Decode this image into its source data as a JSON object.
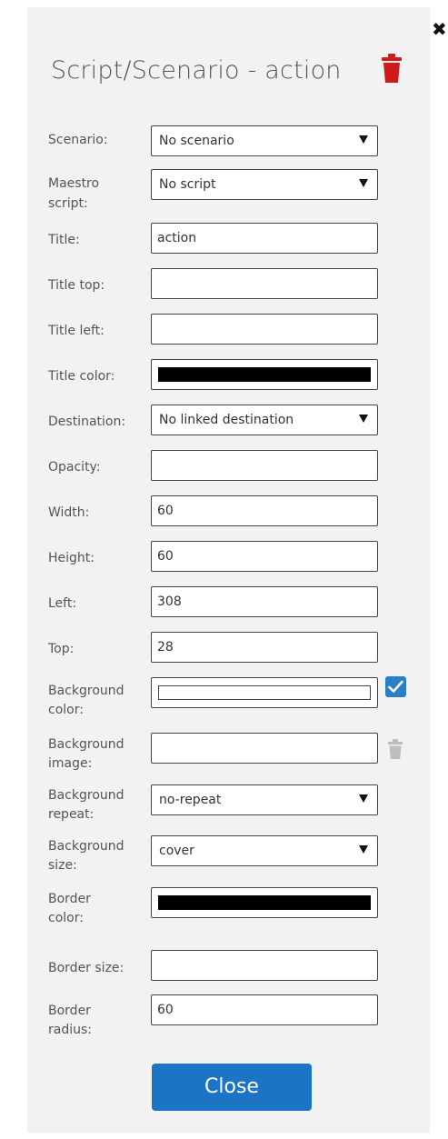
{
  "dialog": {
    "title": "Script/Scenario - action",
    "close_label": "Close"
  },
  "fields": {
    "scenario": {
      "label": "Scenario:",
      "value": "No scenario"
    },
    "maestro": {
      "label1": "Maestro",
      "label2": "script:",
      "value": "No script"
    },
    "title": {
      "label": "Title:",
      "value": "action"
    },
    "title_top": {
      "label": "Title top:",
      "value": ""
    },
    "title_left": {
      "label": "Title left:",
      "value": ""
    },
    "title_color": {
      "label": "Title color:",
      "color": "#000000"
    },
    "destination": {
      "label": "Destination:",
      "value": "No linked destination"
    },
    "opacity": {
      "label": "Opacity:",
      "value": ""
    },
    "width": {
      "label": "Width:",
      "value": "60"
    },
    "height": {
      "label": "Height:",
      "value": "60"
    },
    "left": {
      "label": "Left:",
      "value": "308"
    },
    "top": {
      "label": "Top:",
      "value": "28"
    },
    "bg_color": {
      "label1": "Background",
      "label2": "color:",
      "color": "#ffffff"
    },
    "bg_image": {
      "label1": "Background",
      "label2": "image:",
      "value": ""
    },
    "bg_repeat": {
      "label1": "Background",
      "label2": "repeat:",
      "value": "no-repeat"
    },
    "bg_size": {
      "label1": "Background",
      "label2": "size:",
      "value": "cover"
    },
    "border_color": {
      "label1": "Border",
      "label2": "color:",
      "color": "#000000"
    },
    "border_size": {
      "label": "Border size:",
      "value": ""
    },
    "border_radius": {
      "label1": "Border",
      "label2": "radius:",
      "value": "60"
    }
  },
  "icons": {
    "close": "close-icon",
    "delete": "trash-icon",
    "confirm": "checkmark-icon",
    "clear_image": "trash-icon"
  },
  "colors": {
    "accent": "#1c74c4",
    "delete": "#d11a1a"
  }
}
